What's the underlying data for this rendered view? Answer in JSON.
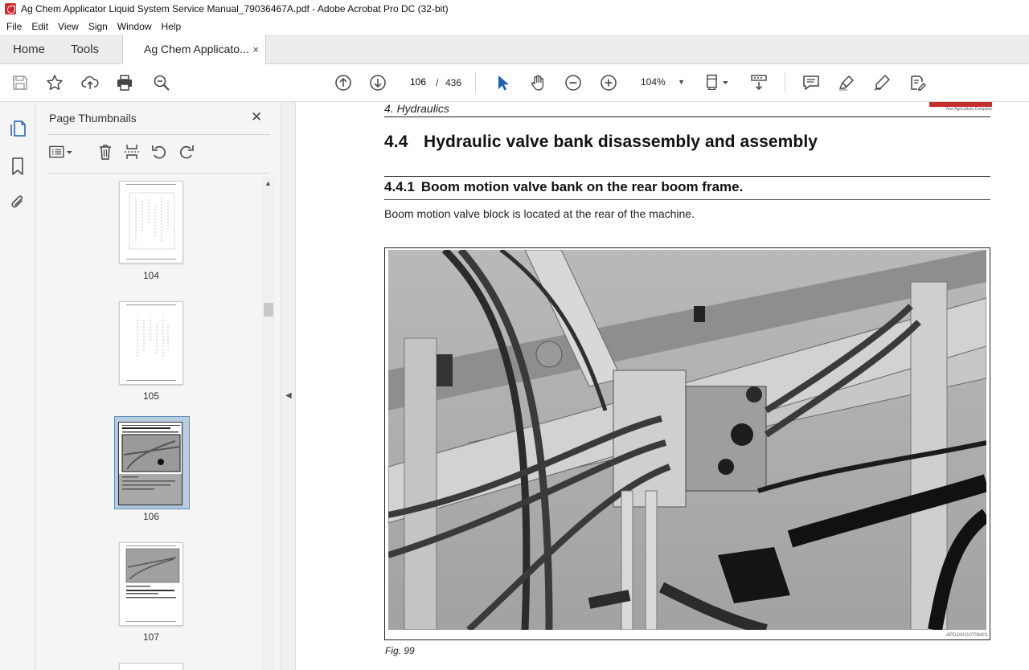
{
  "window": {
    "title": "Ag Chem Applicator Liquid System Service Manual_79036467A.pdf - Adobe Acrobat Pro DC (32-bit)"
  },
  "menu": [
    "File",
    "Edit",
    "View",
    "Sign",
    "Window",
    "Help"
  ],
  "tabs": {
    "home": "Home",
    "tools": "Tools",
    "document": "Ag Chem Applicato...",
    "close_glyph": "×"
  },
  "toolbar": {
    "icons": [
      "save-icon",
      "bookmark-star-icon",
      "upload-icon",
      "print-icon",
      "search-zoom-icon",
      "page-up-icon",
      "page-down-icon",
      "select-cursor-icon",
      "hand-icon",
      "zoom-out-icon",
      "zoom-in-icon",
      "page-fit-icon",
      "scroll-mode-icon",
      "comment-icon",
      "highlight-icon",
      "draw-icon",
      "fill-sign-icon"
    ],
    "current_page": "106",
    "page_separator": "/",
    "total_pages": "436",
    "zoom": "104%",
    "zoom_caret": "▼"
  },
  "left_rail": {
    "icons": [
      "thumbnails-icon",
      "bookmarks-icon",
      "attachments-icon"
    ]
  },
  "thumbnails_panel": {
    "title": "Page Thumbnails",
    "close_glyph": "✕",
    "tools": [
      "options-menu-icon",
      "delete-icon",
      "extract-icon",
      "rotate-left-icon",
      "rotate-right-icon"
    ],
    "pages": [
      {
        "number": "104",
        "selected": false
      },
      {
        "number": "105",
        "selected": false
      },
      {
        "number": "106",
        "selected": true
      },
      {
        "number": "107",
        "selected": false
      }
    ]
  },
  "document": {
    "running_head": "4. Hydraulics",
    "logo_tagline": "Your Agriculture Company",
    "section_number": "4.4",
    "section_title": "Hydraulic valve bank disassembly and assembly",
    "subsection_number": "4.4.1",
    "subsection_title": "Boom motion valve bank on the rear boom frame.",
    "body": "Boom motion valve block is located at the rear of the machine.",
    "figure_code": "APDJA0110706401",
    "figure_caption": "Fig. 99"
  },
  "colors": {
    "accent_red": "#d4262c",
    "selection_blue": "#b8cde0",
    "cursor_blue": "#1a5fb4"
  }
}
